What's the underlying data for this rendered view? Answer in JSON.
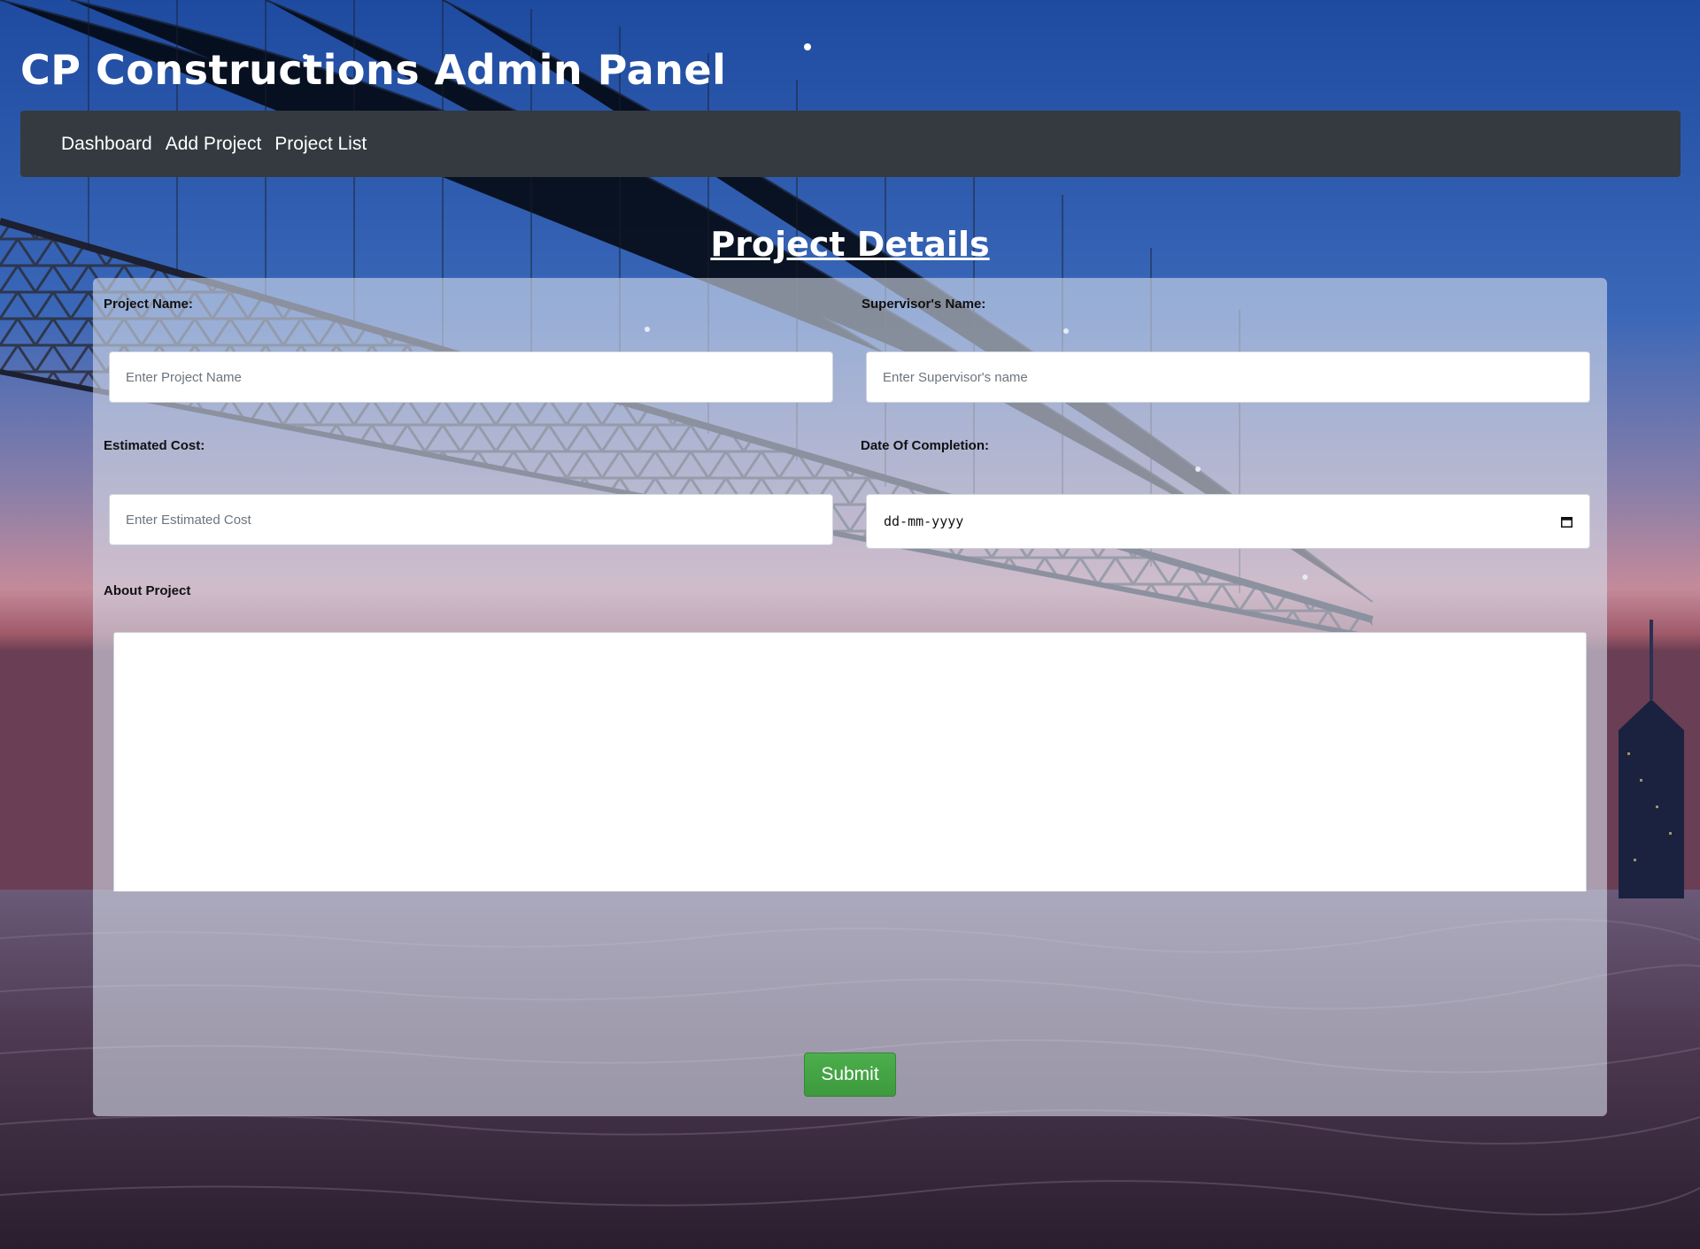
{
  "header": {
    "title": "CP Constructions Admin Panel"
  },
  "nav": {
    "items": [
      {
        "label": "Dashboard"
      },
      {
        "label": "Add Project"
      },
      {
        "label": "Project List"
      }
    ]
  },
  "form": {
    "heading": "Project Details",
    "project_name": {
      "label": "Project Name:",
      "placeholder": "Enter Project Name",
      "value": ""
    },
    "supervisor_name": {
      "label": "Supervisor's Name:",
      "placeholder": "Enter Supervisor's name",
      "value": ""
    },
    "estimated_cost": {
      "label": "Estimated Cost:",
      "placeholder": "Enter Estimated Cost",
      "value": ""
    },
    "completion_date": {
      "label": "Date Of Completion:",
      "display_value": "dd-mm-yyyy"
    },
    "about_project": {
      "label": "About Project",
      "value": ""
    },
    "submit_label": "Submit"
  },
  "colors": {
    "navbar_bg": "#343a40",
    "submit_bg": "#4cae4c",
    "panel_bg": "rgba(215, 222, 235, 0.6)"
  },
  "icons": {
    "date_picker": "calendar-icon"
  }
}
